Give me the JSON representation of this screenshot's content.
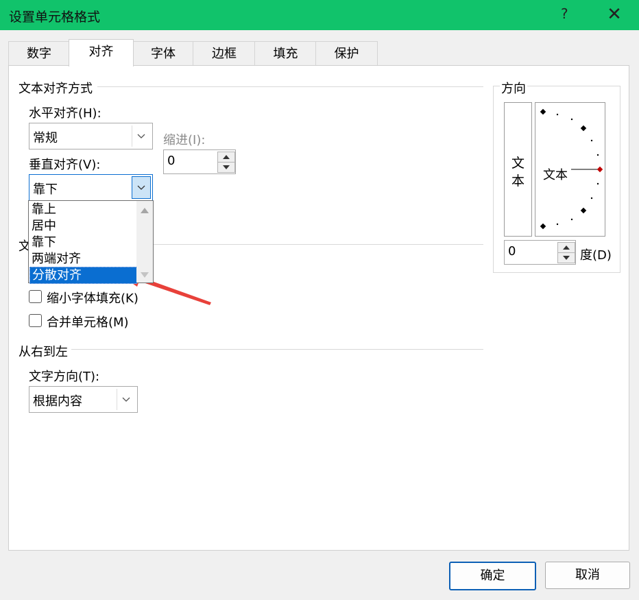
{
  "window": {
    "title": "设置单元格格式",
    "help_label": "?",
    "close_label": "✕"
  },
  "tabs": [
    {
      "label": "数字"
    },
    {
      "label": "对齐"
    },
    {
      "label": "字体"
    },
    {
      "label": "边框"
    },
    {
      "label": "填充"
    },
    {
      "label": "保护"
    }
  ],
  "text_align": {
    "group_label": "文本对齐方式",
    "horizontal_label": "水平对齐(H):",
    "horizontal_value": "常规",
    "indent_label": "缩进(I):",
    "indent_value": "0",
    "vertical_label": "垂直对齐(V):",
    "vertical_value": "靠下",
    "vertical_options": [
      "靠上",
      "居中",
      "靠下",
      "两端对齐",
      "分散对齐"
    ],
    "highlighted_option": "分散对齐"
  },
  "text_control": {
    "group_label_partial": "文",
    "shrink_label": "缩小字体填充(K)",
    "merge_label": "合并单元格(M)"
  },
  "rtl": {
    "group_label": "从右到左",
    "direction_label": "文字方向(T):",
    "direction_value": "根据内容"
  },
  "orientation": {
    "group_label": "方向",
    "vertical_text": [
      "文",
      "本"
    ],
    "dial_text": "文本",
    "degree_value": "0",
    "degree_label": "度(D)"
  },
  "buttons": {
    "ok": "确定",
    "cancel": "取消"
  },
  "colors": {
    "titlebar": "#11c36b",
    "selection": "#0a6ed1",
    "arrow": "#e8413a"
  }
}
